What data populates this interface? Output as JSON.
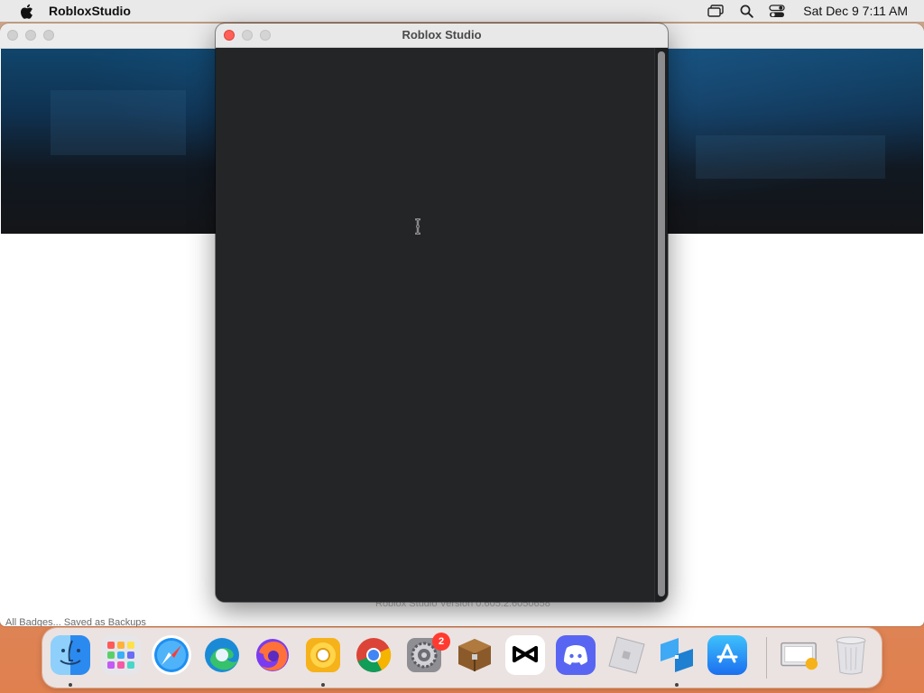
{
  "menubar": {
    "app_name": "RobloxStudio",
    "clock": "Sat Dec 9  7:11 AM",
    "icons": [
      "apple-icon",
      "screen-mirroring-icon",
      "spotlight-search-icon",
      "control-center-icon"
    ]
  },
  "background_window": {
    "footer_text": "Roblox Studio Version 0.605.2.6050658",
    "status_text": "All Badges... Saved as Backups"
  },
  "studio_window": {
    "title": "Roblox Studio"
  },
  "dock": {
    "items": [
      {
        "icon": "finder-icon",
        "running": true
      },
      {
        "icon": "launchpad-icon",
        "running": false
      },
      {
        "icon": "safari-icon",
        "running": false
      },
      {
        "icon": "edge-icon",
        "running": false
      },
      {
        "icon": "firefox-icon",
        "running": false
      },
      {
        "icon": "chrome-canary-icon",
        "running": true
      },
      {
        "icon": "chrome-icon",
        "running": false
      },
      {
        "icon": "system-settings-icon",
        "running": false,
        "badge": "2"
      },
      {
        "icon": "minecraft-chest-icon",
        "running": false
      },
      {
        "icon": "capcut-icon",
        "running": false
      },
      {
        "icon": "discord-icon",
        "running": false
      },
      {
        "icon": "roblox-icon",
        "running": false
      },
      {
        "icon": "roblox-studio-icon",
        "running": true
      },
      {
        "icon": "app-store-icon",
        "running": false
      },
      {
        "icon": "downloads-stack-icon",
        "running": false
      },
      {
        "icon": "trash-icon",
        "running": false
      }
    ],
    "colors": {
      "finder": "#3d9bf5",
      "edge": "#1b8ad6",
      "firefox": "#ff7139",
      "discord": "#5865f2",
      "badge": "#ff3b30"
    }
  }
}
